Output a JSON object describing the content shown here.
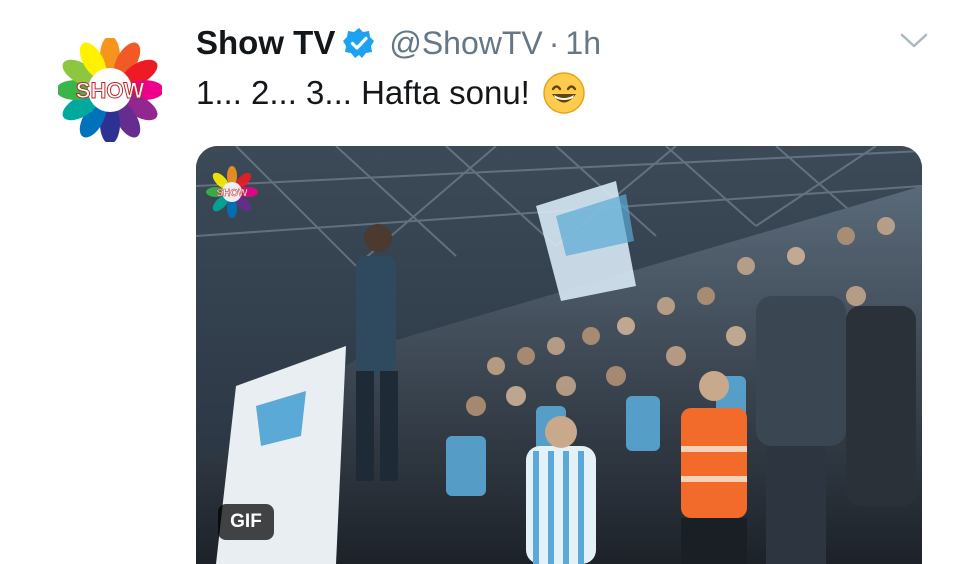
{
  "tweet": {
    "author_name": "Show TV",
    "handle": "@ShowTV",
    "separator": "·",
    "time": "1h",
    "text": "1... 2... 3... Hafta sonu!",
    "emoji": "grinning-face-with-smiling-eyes-icon",
    "verified": true
  },
  "avatar": {
    "logo_text": "SHOW"
  },
  "media": {
    "badge": "GIF",
    "watermark_text": "SHOW",
    "description_colors": {
      "jersey": "#5aa9d6",
      "vest": "#f26b2a",
      "flag": "#d7e9f4"
    }
  },
  "colors": {
    "text": "#14171a",
    "secondary": "#657786",
    "verified": "#1da1f2",
    "chevron": "#aab8c2"
  }
}
